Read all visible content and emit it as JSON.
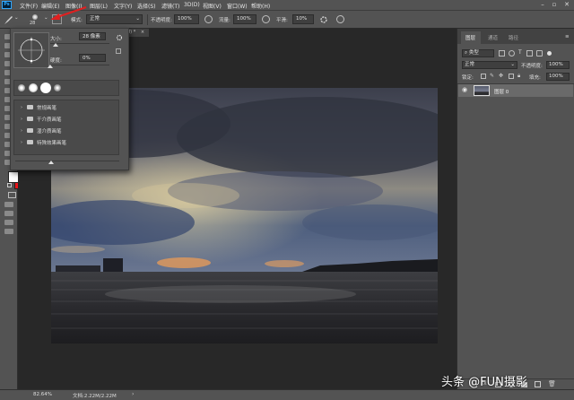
{
  "menubar": {
    "logo": "Ps",
    "items": [
      "文件(F)",
      "编辑(E)",
      "图像(I)",
      "图层(L)",
      "文字(Y)",
      "选择(S)",
      "滤镜(T)",
      "3D(D)",
      "视图(V)",
      "窗口(W)",
      "帮助(H)"
    ]
  },
  "options": {
    "brush_size": "28",
    "mode_label": "模式:",
    "mode_value": "正常",
    "opacity_label": "不透明度:",
    "opacity_value": "100%",
    "flow_label": "流量:",
    "flow_value": "100%",
    "smoothing_label": "平滑:",
    "smoothing_value": "10%"
  },
  "brush_panel": {
    "size_label": "大小:",
    "size_value": "28 像素",
    "hardness_label": "硬度:",
    "hardness_value": "0%",
    "folders": [
      "常规画笔",
      "干介质画笔",
      "湿介质画笔",
      "特殊效果画笔"
    ]
  },
  "document": {
    "tab_label": "8) *"
  },
  "layers_panel": {
    "tabs": [
      "图层",
      "通道",
      "路径"
    ],
    "kind_label": "类型",
    "blend_mode": "正常",
    "opacity_label": "不透明度:",
    "opacity_value": "100%",
    "lock_label": "锁定:",
    "fill_label": "填充:",
    "fill_value": "100%",
    "layer_name": "图层 0"
  },
  "statusbar": {
    "zoom": "82.64%",
    "doc_info": "文档:2.22M/2.22M"
  },
  "watermark": "头条 @FUN摄影",
  "colors": {
    "foreground": "#ffffff",
    "background": "#e8141a",
    "annotation_arrow": "#e02020",
    "ui_panel": "#535353",
    "workspace": "#282828"
  }
}
